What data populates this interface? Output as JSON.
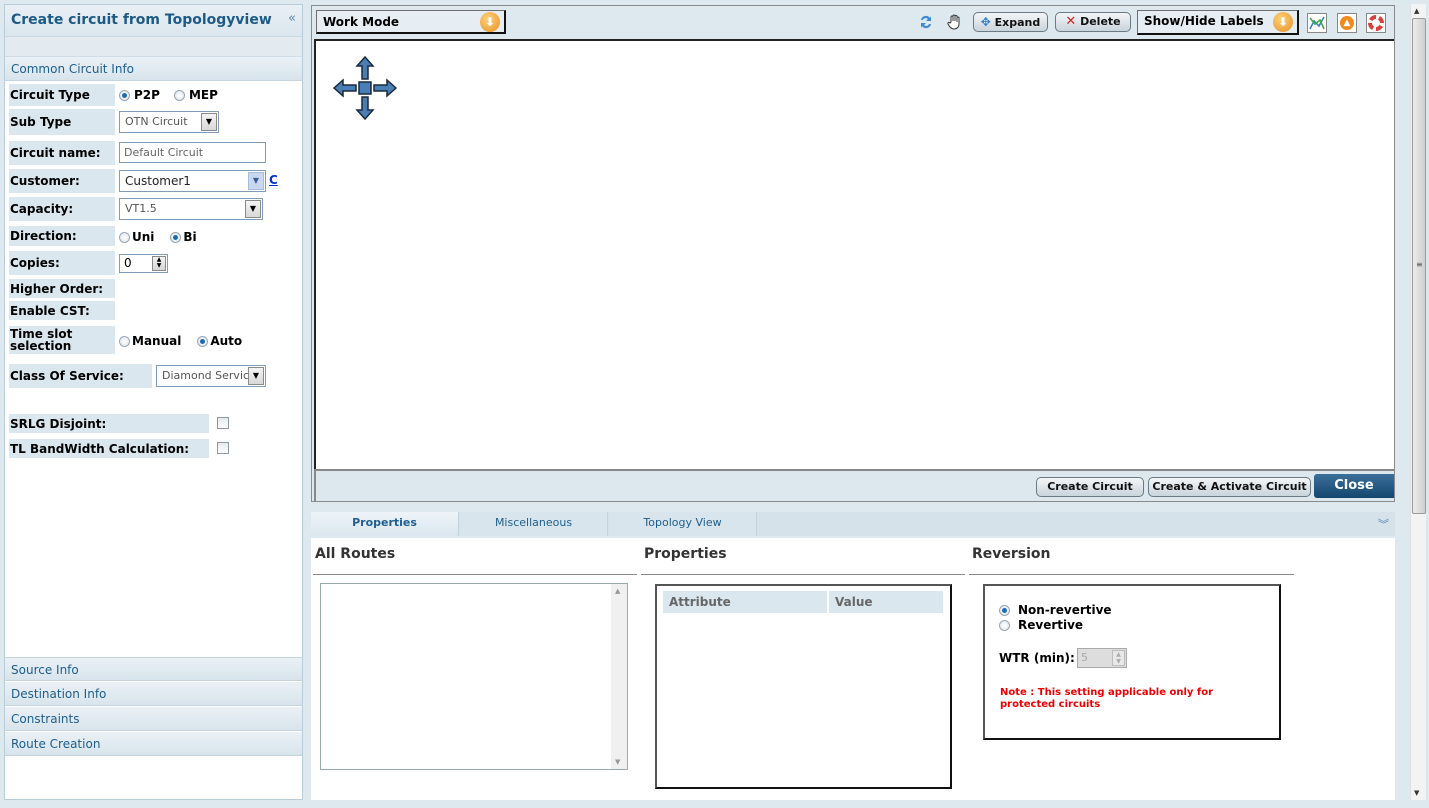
{
  "left_panel": {
    "title": "Create circuit from Topologyview",
    "collapse_glyph": "«",
    "common_section": "Common Circuit Info",
    "fields": {
      "circuit_type": {
        "label": "Circuit Type",
        "options": [
          "P2P",
          "MEP"
        ],
        "selected": "P2P"
      },
      "sub_type": {
        "label": "Sub Type",
        "value": "OTN Circuit"
      },
      "circuit_name": {
        "label": "Circuit name:",
        "value": "Default Circuit"
      },
      "customer": {
        "label": "Customer:",
        "value": "Customer1",
        "link": "C"
      },
      "capacity": {
        "label": "Capacity:",
        "value": "VT1.5"
      },
      "direction": {
        "label": "Direction:",
        "options": [
          "Uni",
          "Bi"
        ],
        "selected": "Bi"
      },
      "copies": {
        "label": "Copies:",
        "value": "0"
      },
      "higher_order": {
        "label": "Higher Order:"
      },
      "enable_cst": {
        "label": "Enable CST:"
      },
      "time_slot": {
        "label": "Time slot selection",
        "options": [
          "Manual",
          "Auto"
        ],
        "selected": "Auto"
      },
      "class_of_service": {
        "label": "Class Of Service:",
        "value": "Diamond Service"
      },
      "srlg_disjoint": {
        "label": "SRLG Disjoint:",
        "checked": false
      },
      "tl_bandwidth": {
        "label": "TL BandWidth Calculation:",
        "checked": false
      }
    },
    "bottom_sections": [
      "Source Info",
      "Destination Info",
      "Constraints",
      "Route Creation"
    ]
  },
  "toolbar": {
    "work_mode": "Work Mode",
    "expand": "Expand",
    "delete": "Delete",
    "show_hide_labels": "Show/Hide Labels",
    "icons": [
      "refresh-icon",
      "hand-pan-icon",
      "expand-icon",
      "delete-x-icon",
      "topology-graph-icon",
      "alarm-bell-icon",
      "help-lifebuoy-icon"
    ]
  },
  "actions": {
    "create_circuit": "Create Circuit",
    "create_activate": "Create & Activate Circuit",
    "close": "Close"
  },
  "tabs": [
    {
      "label": "Properties",
      "active": true
    },
    {
      "label": "Miscellaneous",
      "active": false
    },
    {
      "label": "Topology View",
      "active": false
    }
  ],
  "properties_tab": {
    "all_routes_title": "All Routes",
    "properties_title": "Properties",
    "properties_columns": [
      "Attribute",
      "Value"
    ],
    "reversion_title": "Reversion",
    "reversion_options": [
      "Non-revertive",
      "Revertive"
    ],
    "reversion_selected": "Non-revertive",
    "wtr_label": "WTR (min):",
    "wtr_value": "5",
    "note": "Note : This setting applicable only for protected circuits"
  },
  "colors": {
    "accent": "#1d5a86",
    "close_button": "#1f5580",
    "note_red": "#e00000"
  }
}
